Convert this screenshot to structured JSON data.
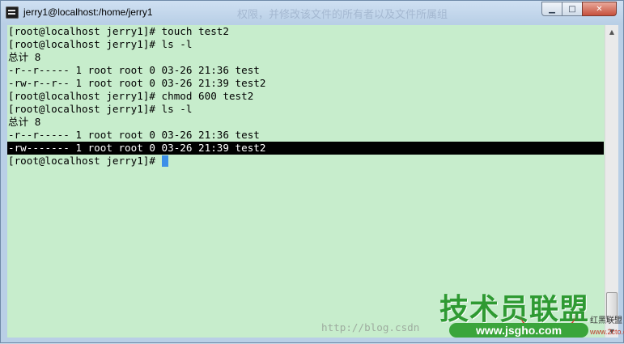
{
  "window": {
    "title": "jerry1@localhost:/home/jerry1",
    "ghost_title": "权限，并修改该文件的所有者以及文件所属组",
    "buttons": {
      "minimize": "▁",
      "maximize": "□",
      "close": "✕"
    }
  },
  "terminal": {
    "lines": [
      "[root@localhost jerry1]# touch test2",
      "[root@localhost jerry1]# ls -l",
      "总计 8",
      "-r--r----- 1 root root 0 03-26 21:36 test",
      "-rw-r--r-- 1 root root 0 03-26 21:39 test2",
      "[root@localhost jerry1]# chmod 600 test2",
      "[root@localhost jerry1]# ls -l",
      "总计 8",
      "-r--r----- 1 root root 0 03-26 21:36 test",
      "-rw------- 1 root root 0 03-26 21:39 test2"
    ],
    "prompt": "[root@localhost jerry1]# ",
    "watermark_url": "http://blog.csdn"
  },
  "logo": {
    "chinese": "技术员联盟",
    "url": "www.jsgho.com",
    "small_text": "红黑联盟",
    "small_url": "www.2cto.com"
  },
  "colors": {
    "terminal_bg": "#c7edcc",
    "cursor": "#3d8fe8",
    "selection_bg": "#000000"
  }
}
